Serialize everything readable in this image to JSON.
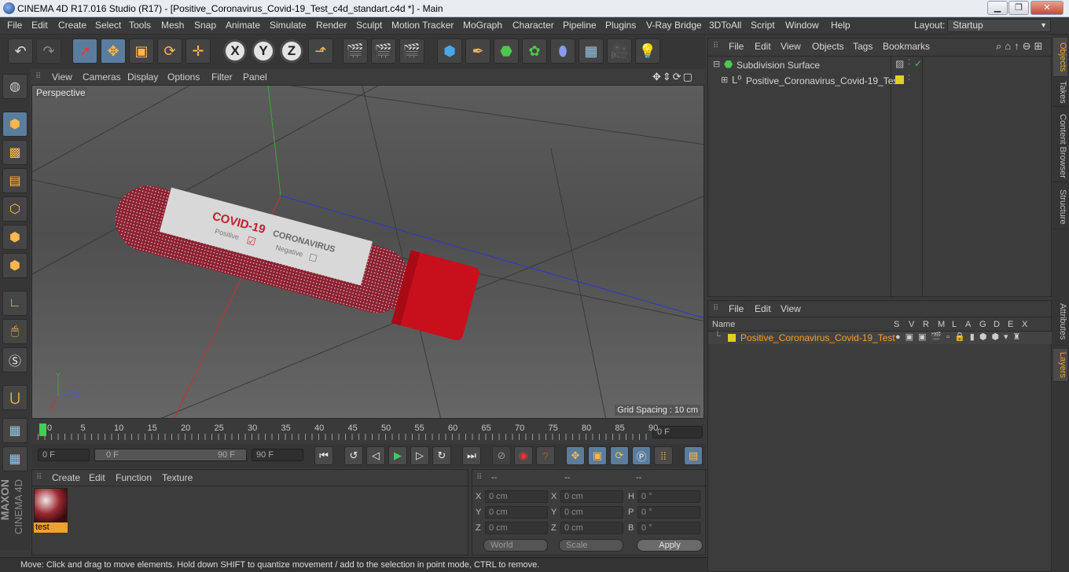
{
  "window": {
    "title": "CINEMA 4D R17.016 Studio (R17) - [Positive_Coronavirus_Covid-19_Test_c4d_standart.c4d *] - Main"
  },
  "menu": [
    "File",
    "Edit",
    "Create",
    "Select",
    "Tools",
    "Mesh",
    "Snap",
    "Animate",
    "Simulate",
    "Render",
    "Sculpt",
    "Motion Tracker",
    "MoGraph",
    "Character",
    "Pipeline",
    "Plugins",
    "V-Ray Bridge",
    "3DToAll",
    "Script",
    "Window",
    "Help"
  ],
  "layout": {
    "label": "Layout:",
    "value": "Startup"
  },
  "viewport": {
    "menu": [
      "View",
      "Cameras",
      "Display",
      "Options",
      "Filter",
      "Panel"
    ],
    "camera": "Perspective",
    "grid_spacing": "Grid Spacing : 10 cm",
    "tube_label_main": "COVID-19",
    "tube_label_sub": "CORONAVIRUS",
    "tube_positive": "Positive",
    "tube_negative": "Negative"
  },
  "timeline": {
    "ticks": [
      "0",
      "5",
      "10",
      "15",
      "20",
      "25",
      "30",
      "35",
      "40",
      "45",
      "50",
      "55",
      "60",
      "65",
      "70",
      "75",
      "80",
      "85",
      "90"
    ],
    "current_frame": "0 F",
    "start": "0 F",
    "range_start": "0 F",
    "range_end": "90 F",
    "end": "90 F"
  },
  "materials": {
    "menu": [
      "Create",
      "Edit",
      "Function",
      "Texture"
    ],
    "items": [
      {
        "name": "test"
      }
    ]
  },
  "coords": {
    "headers": [
      "--",
      "--",
      "--"
    ],
    "rows": [
      {
        "a": "X",
        "av": "0 cm",
        "b": "X",
        "bv": "0 cm",
        "c": "H",
        "cv": "0 °"
      },
      {
        "a": "Y",
        "av": "0 cm",
        "b": "Y",
        "bv": "0 cm",
        "c": "P",
        "cv": "0 °"
      },
      {
        "a": "Z",
        "av": "0 cm",
        "b": "Z",
        "bv": "0 cm",
        "c": "B",
        "cv": "0 °"
      }
    ],
    "space": "World",
    "mode": "Scale",
    "apply": "Apply"
  },
  "objects": {
    "menu": [
      "File",
      "Edit",
      "View",
      "Objects",
      "Tags",
      "Bookmarks"
    ],
    "items": [
      {
        "name": "Subdivision Surface"
      },
      {
        "name": "Positive_Coronavirus_Covid-19_Test"
      }
    ]
  },
  "layers": {
    "menu": [
      "File",
      "Edit",
      "View"
    ],
    "name_header": "Name",
    "flags": [
      "S",
      "V",
      "R",
      "M",
      "L",
      "A",
      "G",
      "D",
      "E",
      "X"
    ],
    "items": [
      {
        "name": "Positive_Coronavirus_Covid-19_Test"
      }
    ]
  },
  "side_tabs": [
    "Objects",
    "Takes",
    "Content Browser",
    "Structure",
    "Attributes",
    "Layers"
  ],
  "brand": {
    "line1": "MAXON",
    "line2": "CINEMA 4D"
  },
  "status": "Move: Click and drag to move elements. Hold down SHIFT to quantize movement / add to the selection in point mode, CTRL to remove.",
  "colors": {
    "accent": "#f0a030",
    "layer_yellow": "#e0d020",
    "tube_red": "#c0101c"
  }
}
